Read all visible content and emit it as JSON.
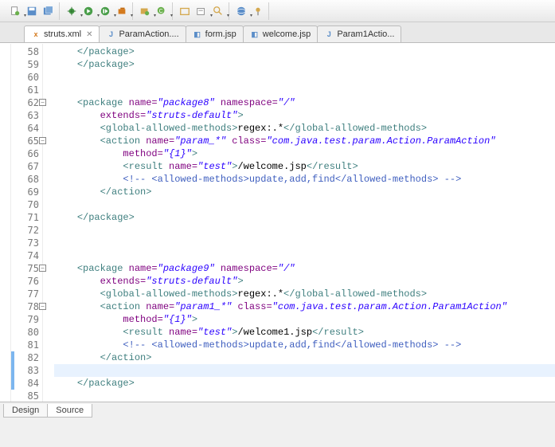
{
  "tabs": [
    {
      "label": "struts.xml",
      "icon": "xml",
      "active": true,
      "dirty": false,
      "closeable": true
    },
    {
      "label": "ParamAction....",
      "icon": "java",
      "active": false
    },
    {
      "label": "form.jsp",
      "icon": "jsp",
      "active": false
    },
    {
      "label": "welcome.jsp",
      "icon": "jsp",
      "active": false
    },
    {
      "label": "Param1Actio...",
      "icon": "java",
      "active": false
    }
  ],
  "bottom_tabs": {
    "design": "Design",
    "source": "Source",
    "active": "source"
  },
  "gutter": {
    "start": 58,
    "end": 85,
    "foldable": [
      62,
      65,
      75,
      78
    ],
    "changed": [
      82,
      83,
      84
    ],
    "highlighted": 83
  },
  "code": {
    "lines": [
      {
        "n": 58,
        "ind": 1,
        "seg": [
          {
            "c": "t-tag",
            "t": "</package>"
          }
        ]
      },
      {
        "n": 59,
        "ind": 1,
        "seg": [
          {
            "c": "t-tag",
            "t": "</package>"
          }
        ]
      },
      {
        "n": 60,
        "ind": 0,
        "seg": []
      },
      {
        "n": 61,
        "ind": 0,
        "seg": []
      },
      {
        "n": 62,
        "ind": 1,
        "seg": [
          {
            "c": "t-tag",
            "t": "<package "
          },
          {
            "c": "t-attr",
            "t": "name="
          },
          {
            "c": "t-val",
            "t": "\"package8\""
          },
          {
            "c": "t-attr",
            "t": " namespace="
          },
          {
            "c": "t-val",
            "t": "\"/\""
          }
        ]
      },
      {
        "n": 63,
        "ind": 2,
        "seg": [
          {
            "c": "t-attr",
            "t": "extends="
          },
          {
            "c": "t-val",
            "t": "\"struts-default\""
          },
          {
            "c": "t-tag",
            "t": ">"
          }
        ]
      },
      {
        "n": 64,
        "ind": 2,
        "seg": [
          {
            "c": "t-tag",
            "t": "<global-allowed-methods>"
          },
          {
            "c": "t-text",
            "t": "regex:.*"
          },
          {
            "c": "t-tag",
            "t": "</global-allowed-methods>"
          }
        ]
      },
      {
        "n": 65,
        "ind": 2,
        "seg": [
          {
            "c": "t-tag",
            "t": "<action "
          },
          {
            "c": "t-attr",
            "t": "name="
          },
          {
            "c": "t-val",
            "t": "\"param_*\""
          },
          {
            "c": "t-attr",
            "t": " class="
          },
          {
            "c": "t-val",
            "t": "\"com.java.test.param.Action.ParamAction\""
          }
        ]
      },
      {
        "n": 66,
        "ind": 3,
        "seg": [
          {
            "c": "t-attr",
            "t": "method="
          },
          {
            "c": "t-val",
            "t": "\"{1}\""
          },
          {
            "c": "t-tag",
            "t": ">"
          }
        ]
      },
      {
        "n": 67,
        "ind": 3,
        "seg": [
          {
            "c": "t-tag",
            "t": "<result "
          },
          {
            "c": "t-attr",
            "t": "name="
          },
          {
            "c": "t-val",
            "t": "\"test\""
          },
          {
            "c": "t-tag",
            "t": ">"
          },
          {
            "c": "t-text",
            "t": "/welcome.jsp"
          },
          {
            "c": "t-tag",
            "t": "</result>"
          }
        ]
      },
      {
        "n": 68,
        "ind": 3,
        "seg": [
          {
            "c": "t-comment",
            "t": "<!-- <allowed-methods>update,add,find</allowed-methods> -->"
          }
        ]
      },
      {
        "n": 69,
        "ind": 2,
        "seg": [
          {
            "c": "t-tag",
            "t": "</action>"
          }
        ]
      },
      {
        "n": 70,
        "ind": 0,
        "seg": []
      },
      {
        "n": 71,
        "ind": 1,
        "seg": [
          {
            "c": "t-tag",
            "t": "</package>"
          }
        ]
      },
      {
        "n": 72,
        "ind": 0,
        "seg": []
      },
      {
        "n": 73,
        "ind": 0,
        "seg": []
      },
      {
        "n": 74,
        "ind": 0,
        "seg": []
      },
      {
        "n": 75,
        "ind": 1,
        "seg": [
          {
            "c": "t-tag",
            "t": "<package "
          },
          {
            "c": "t-attr",
            "t": "name="
          },
          {
            "c": "t-val",
            "t": "\"package9\""
          },
          {
            "c": "t-attr",
            "t": " namespace="
          },
          {
            "c": "t-val",
            "t": "\"/\""
          }
        ]
      },
      {
        "n": 76,
        "ind": 2,
        "seg": [
          {
            "c": "t-attr",
            "t": "extends="
          },
          {
            "c": "t-val",
            "t": "\"struts-default\""
          },
          {
            "c": "t-tag",
            "t": ">"
          }
        ]
      },
      {
        "n": 77,
        "ind": 2,
        "seg": [
          {
            "c": "t-tag",
            "t": "<global-allowed-methods>"
          },
          {
            "c": "t-text",
            "t": "regex:.*"
          },
          {
            "c": "t-tag",
            "t": "</global-allowed-methods>"
          }
        ]
      },
      {
        "n": 78,
        "ind": 2,
        "seg": [
          {
            "c": "t-tag",
            "t": "<action "
          },
          {
            "c": "t-attr",
            "t": "name="
          },
          {
            "c": "t-val",
            "t": "\"param1_*\""
          },
          {
            "c": "t-attr",
            "t": " class="
          },
          {
            "c": "t-val",
            "t": "\"com.java.test.param.Action.Param1Action\""
          }
        ]
      },
      {
        "n": 79,
        "ind": 3,
        "seg": [
          {
            "c": "t-attr",
            "t": "method="
          },
          {
            "c": "t-val",
            "t": "\"{1}\""
          },
          {
            "c": "t-tag",
            "t": ">"
          }
        ]
      },
      {
        "n": 80,
        "ind": 3,
        "seg": [
          {
            "c": "t-tag",
            "t": "<result "
          },
          {
            "c": "t-attr",
            "t": "name="
          },
          {
            "c": "t-val",
            "t": "\"test\""
          },
          {
            "c": "t-tag",
            "t": ">"
          },
          {
            "c": "t-text",
            "t": "/welcome1.jsp"
          },
          {
            "c": "t-tag",
            "t": "</result>"
          }
        ]
      },
      {
        "n": 81,
        "ind": 3,
        "seg": [
          {
            "c": "t-comment",
            "t": "<!-- <allowed-methods>update,add,find</allowed-methods> -->"
          }
        ]
      },
      {
        "n": 82,
        "ind": 2,
        "seg": [
          {
            "c": "t-tag",
            "t": "</action>"
          }
        ]
      },
      {
        "n": 83,
        "ind": 0,
        "seg": []
      },
      {
        "n": 84,
        "ind": 1,
        "seg": [
          {
            "c": "t-tag",
            "t": "</package>"
          }
        ]
      },
      {
        "n": 85,
        "ind": 0,
        "seg": []
      }
    ]
  }
}
